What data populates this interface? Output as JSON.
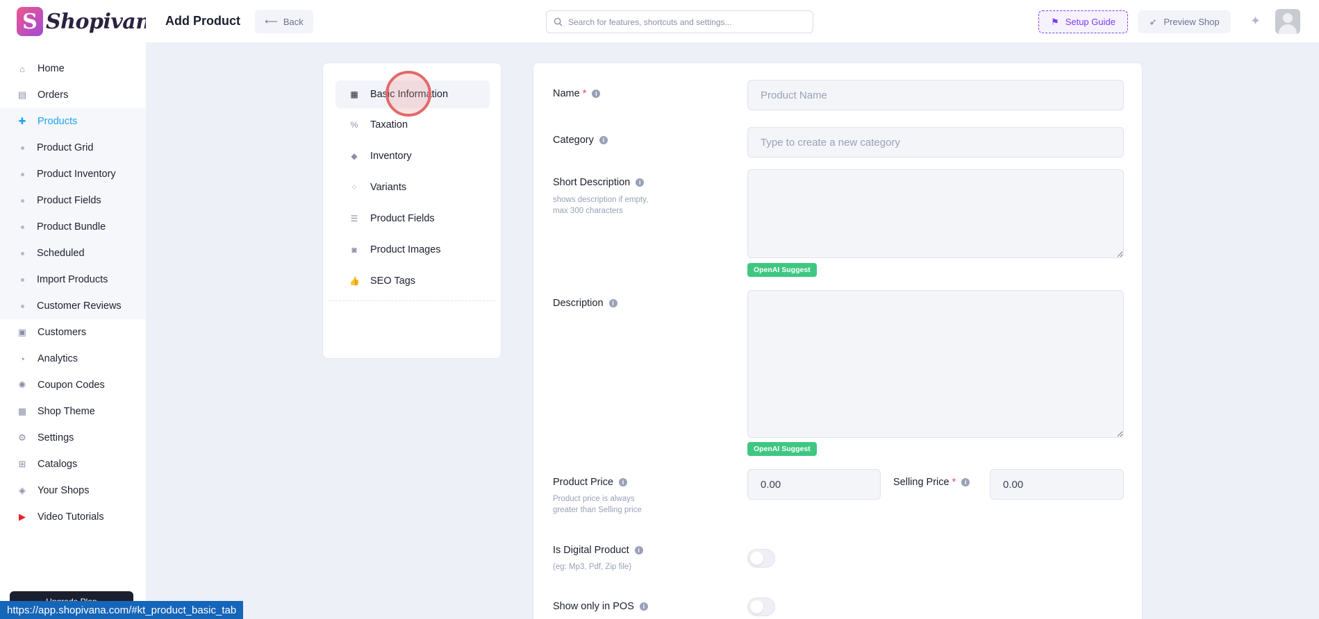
{
  "brand": {
    "logo_letter": "S",
    "name": "Shopivana"
  },
  "sidebar": {
    "items": [
      {
        "label": "Home",
        "icon": "home-icon"
      },
      {
        "label": "Orders",
        "icon": "clipboard-icon"
      },
      {
        "label": "Products",
        "icon": "gift-icon",
        "active": true
      }
    ],
    "sub_items": [
      "Product Grid",
      "Product Inventory",
      "Product Fields",
      "Product Bundle",
      "Scheduled",
      "Import Products",
      "Customer Reviews"
    ],
    "items_after": [
      {
        "label": "Customers",
        "icon": "user-card-icon"
      },
      {
        "label": "Analytics",
        "icon": "pie-chart-icon"
      },
      {
        "label": "Coupon Codes",
        "icon": "percent-badge-icon"
      },
      {
        "label": "Shop Theme",
        "icon": "layout-icon"
      },
      {
        "label": "Settings",
        "icon": "gear-icon"
      },
      {
        "label": "Catalogs",
        "icon": "grid-icon"
      },
      {
        "label": "Your Shops",
        "icon": "layers-icon"
      },
      {
        "label": "Video Tutorials",
        "icon": "youtube-icon"
      }
    ],
    "upgrade_label": "Upgrade Plan"
  },
  "header": {
    "title": "Add Product",
    "back_label": "Back",
    "search_placeholder": "Search for features, shortcuts and settings...",
    "setup_label": "Setup Guide",
    "preview_label": "Preview Shop"
  },
  "tabs": [
    {
      "label": "Basic Information",
      "icon": "table-icon",
      "active": true
    },
    {
      "label": "Taxation",
      "icon": "percent-icon"
    },
    {
      "label": "Inventory",
      "icon": "box-icon"
    },
    {
      "label": "Variants",
      "icon": "variants-icon"
    },
    {
      "label": "Product Fields",
      "icon": "list-icon"
    },
    {
      "label": "Product Images",
      "icon": "camera-icon"
    },
    {
      "label": "SEO Tags",
      "icon": "thumbs-up-icon"
    }
  ],
  "form": {
    "name_label": "Name",
    "name_placeholder": "Product Name",
    "category_label": "Category",
    "category_placeholder": "Type to create a new category",
    "short_desc_label": "Short Description",
    "short_desc_hint_1": "shows description if empty,",
    "short_desc_hint_2": "max 300 characters",
    "ai_label": "OpenAI Suggest",
    "desc_label": "Description",
    "product_price_label": "Product Price",
    "product_price_value": "0.00",
    "product_price_hint_1": "Product price is always",
    "product_price_hint_2": "greater than Selling price",
    "selling_price_label": "Selling Price",
    "selling_price_value": "0.00",
    "digital_label": "Is Digital Product",
    "digital_hint": "(eg: Mp3, Pdf, Zip file)",
    "pos_label": "Show only in POS",
    "required_mark": "*",
    "info_glyph": "i"
  },
  "status_bar": {
    "url": "https://app.shopivana.com/#kt_product_basic_tab"
  },
  "colors": {
    "accent": "#1da1f2",
    "purple": "#7a3cf0",
    "green": "#3fc782",
    "required": "#f1416c"
  }
}
